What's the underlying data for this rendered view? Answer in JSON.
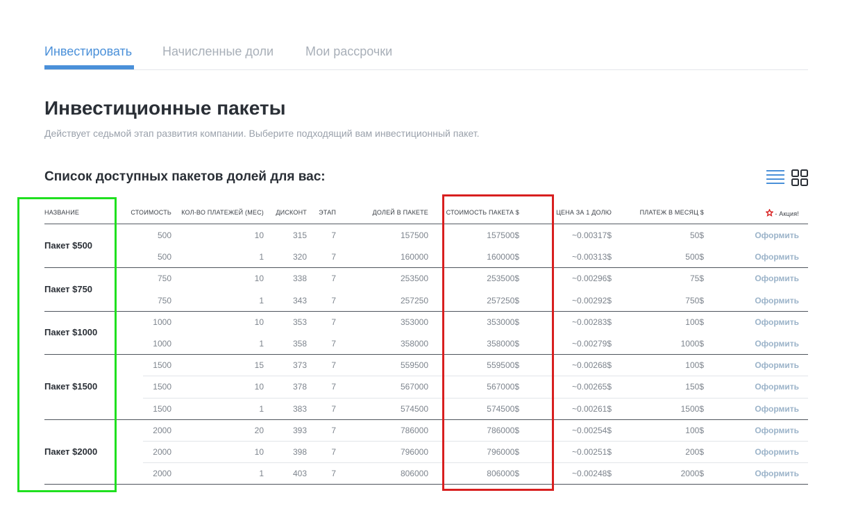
{
  "tabs": [
    {
      "label": "Инвестировать",
      "active": true
    },
    {
      "label": "Начисленные доли",
      "active": false
    },
    {
      "label": "Мои рассрочки",
      "active": false
    }
  ],
  "page": {
    "title": "Инвестиционные пакеты",
    "subtitle": "Действует седьмой этап развития компании. Выберите подходящий вам инвестиционный пакет.",
    "section_title": "Список доступных пакетов долей для вас:"
  },
  "view_icons": [
    "list-view-icon",
    "grid-view-icon"
  ],
  "colors": {
    "accent": "#4a90d9",
    "action": "#9bb3c9",
    "highlight_green": "#1fe01f",
    "highlight_red": "#d81f1f",
    "promo_star": "#d81f1f"
  },
  "table": {
    "headers": {
      "name": "НАЗВАНИЕ",
      "cost": "СТОИМОСТЬ",
      "payments": "КОЛ-ВО ПЛАТЕЖЕЙ (МЕС)",
      "discount": "ДИСКОНТ",
      "stage": "ЭТАП",
      "shares": "ДОЛЕЙ В ПАКЕТЕ",
      "package_cost": "СТОИМОСТЬ ПАКЕТА $",
      "price_per_share": "ЦЕНА ЗА 1 ДОЛЮ",
      "monthly": "ПЛАТЕЖ В МЕСЯЦ $",
      "promo": "- Акция!"
    },
    "action_label": "Оформить",
    "groups": [
      {
        "name": "Пакет $500",
        "rows": [
          {
            "cost": "500",
            "payments": "10",
            "discount": "315",
            "stage": "7",
            "shares": "157500",
            "package_cost": "157500$",
            "price": "~0.00317$",
            "monthly": "50$"
          },
          {
            "cost": "500",
            "payments": "1",
            "discount": "320",
            "stage": "7",
            "shares": "160000",
            "package_cost": "160000$",
            "price": "~0.00313$",
            "monthly": "500$"
          }
        ]
      },
      {
        "name": "Пакет $750",
        "rows": [
          {
            "cost": "750",
            "payments": "10",
            "discount": "338",
            "stage": "7",
            "shares": "253500",
            "package_cost": "253500$",
            "price": "~0.00296$",
            "monthly": "75$"
          },
          {
            "cost": "750",
            "payments": "1",
            "discount": "343",
            "stage": "7",
            "shares": "257250",
            "package_cost": "257250$",
            "price": "~0.00292$",
            "monthly": "750$"
          }
        ]
      },
      {
        "name": "Пакет $1000",
        "rows": [
          {
            "cost": "1000",
            "payments": "10",
            "discount": "353",
            "stage": "7",
            "shares": "353000",
            "package_cost": "353000$",
            "price": "~0.00283$",
            "monthly": "100$"
          },
          {
            "cost": "1000",
            "payments": "1",
            "discount": "358",
            "stage": "7",
            "shares": "358000",
            "package_cost": "358000$",
            "price": "~0.00279$",
            "monthly": "1000$"
          }
        ]
      },
      {
        "name": "Пакет $1500",
        "rows": [
          {
            "cost": "1500",
            "payments": "15",
            "discount": "373",
            "stage": "7",
            "shares": "559500",
            "package_cost": "559500$",
            "price": "~0.00268$",
            "monthly": "100$"
          },
          {
            "cost": "1500",
            "payments": "10",
            "discount": "378",
            "stage": "7",
            "shares": "567000",
            "package_cost": "567000$",
            "price": "~0.00265$",
            "monthly": "150$"
          },
          {
            "cost": "1500",
            "payments": "1",
            "discount": "383",
            "stage": "7",
            "shares": "574500",
            "package_cost": "574500$",
            "price": "~0.00261$",
            "monthly": "1500$"
          }
        ]
      },
      {
        "name": "Пакет $2000",
        "rows": [
          {
            "cost": "2000",
            "payments": "20",
            "discount": "393",
            "stage": "7",
            "shares": "786000",
            "package_cost": "786000$",
            "price": "~0.00254$",
            "monthly": "100$"
          },
          {
            "cost": "2000",
            "payments": "10",
            "discount": "398",
            "stage": "7",
            "shares": "796000",
            "package_cost": "796000$",
            "price": "~0.00251$",
            "monthly": "200$"
          },
          {
            "cost": "2000",
            "payments": "1",
            "discount": "403",
            "stage": "7",
            "shares": "806000",
            "package_cost": "806000$",
            "price": "~0.00248$",
            "monthly": "2000$"
          }
        ]
      }
    ]
  }
}
